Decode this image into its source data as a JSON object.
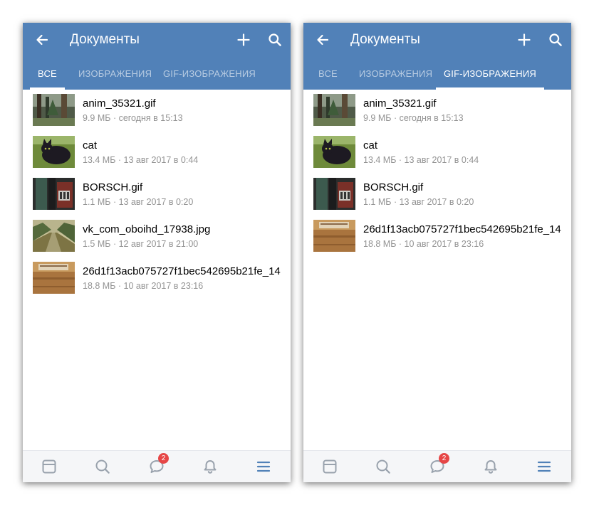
{
  "screens": [
    {
      "title": "Документы",
      "tabs": [
        {
          "label": "ВСЕ",
          "active": true
        },
        {
          "label": "ИЗОБРАЖЕНИЯ",
          "active": false
        },
        {
          "label": "GIF-ИЗОБРАЖЕНИЯ",
          "active": false
        }
      ],
      "documents": [
        {
          "name": "anim_35321.gif",
          "meta": "9.9 МБ · сегодня в 15:13",
          "thumb": "forest-thumbnail"
        },
        {
          "name": "cat",
          "meta": "13.4 МБ · 13 авг 2017 в 0:44",
          "thumb": "cat-thumbnail"
        },
        {
          "name": "BORSCH.gif",
          "meta": "1.1 МБ · 13 авг 2017 в 0:20",
          "thumb": "room-thumbnail"
        },
        {
          "name": "vk_com_oboihd_17938.jpg",
          "meta": "1.5 МБ · 12 авг 2017 в 21:00",
          "thumb": "valley-road-thumbnail"
        },
        {
          "name": "26d1f13acb075727f1bec542695b21fe_14",
          "meta": "18.8 МБ · 10 авг 2017 в 23:16",
          "thumb": "box-thumbnail"
        }
      ],
      "badge": "2"
    },
    {
      "title": "Документы",
      "tabs": [
        {
          "label": "ВСЕ",
          "active": false
        },
        {
          "label": "ИЗОБРАЖЕНИЯ",
          "active": false
        },
        {
          "label": "GIF-ИЗОБРАЖЕНИЯ",
          "active": true
        }
      ],
      "documents": [
        {
          "name": "anim_35321.gif",
          "meta": "9.9 МБ · сегодня в 15:13",
          "thumb": "forest-thumbnail"
        },
        {
          "name": "cat",
          "meta": "13.4 МБ · 13 авг 2017 в 0:44",
          "thumb": "cat-thumbnail"
        },
        {
          "name": "BORSCH.gif",
          "meta": "1.1 МБ · 13 авг 2017 в 0:20",
          "thumb": "room-thumbnail"
        },
        {
          "name": "26d1f13acb075727f1bec542695b21fe_14",
          "meta": "18.8 МБ · 10 авг 2017 в 23:16",
          "thumb": "box-thumbnail"
        }
      ],
      "badge": "2"
    }
  ],
  "colors": {
    "header": "#5181b8",
    "tab_inactive": "rgba(255,255,255,0.58)",
    "nav_icon": "#99a2ad",
    "nav_active": "#5181b8",
    "badge": "#e64646",
    "meta_text": "#939393"
  },
  "icons": {
    "header": [
      "arrow-back-icon",
      "plus-icon",
      "search-icon"
    ],
    "bottom_nav": [
      "newsfeed-icon",
      "search-icon",
      "messages-icon",
      "notifications-bell-icon",
      "menu-icon"
    ]
  }
}
